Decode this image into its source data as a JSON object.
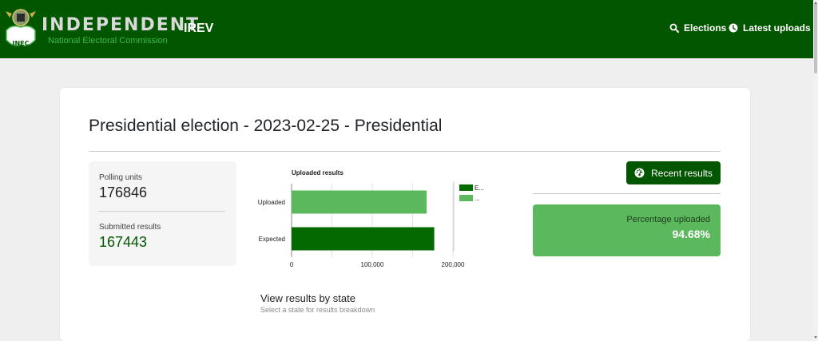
{
  "header": {
    "brand_title": "INDEPENDENT",
    "brand_subtitle": "National Electoral Commission",
    "logo_text": "INEC",
    "app_name": "IREV",
    "nav": [
      {
        "label": "Elections",
        "icon": "search-icon"
      },
      {
        "label": "Latest uploads",
        "icon": "clock-icon"
      }
    ],
    "bg_color": "#035600"
  },
  "page": {
    "title": "Presidential election - 2023-02-25 - Presidential"
  },
  "stats": {
    "polling_units_label": "Polling units",
    "polling_units_value": "176846",
    "submitted_label": "Submitted results",
    "submitted_value": "167443"
  },
  "chart_data": {
    "type": "bar",
    "orientation": "horizontal",
    "title": "Uploaded results",
    "categories": [
      "Uploaded",
      "Expected"
    ],
    "values": [
      167443,
      176846
    ],
    "colors": [
      "#5cb85c",
      "#046a00"
    ],
    "xlim": [
      0,
      200000
    ],
    "xticks": [
      0,
      100000,
      200000
    ],
    "xtick_labels": [
      "0",
      "100,000",
      "200,000"
    ],
    "grid": true,
    "legend": {
      "placement": "right",
      "entries": [
        "E...",
        "..."
      ]
    }
  },
  "side": {
    "recent_button_label": "Recent results",
    "recent_icon": "gauge-icon",
    "percentage_label": "Percentage uploaded",
    "percentage_value": "94.68%",
    "accent": "#5cb85c"
  },
  "states": {
    "title": "View results by state",
    "subtitle": "Select a state for results breakdown"
  }
}
